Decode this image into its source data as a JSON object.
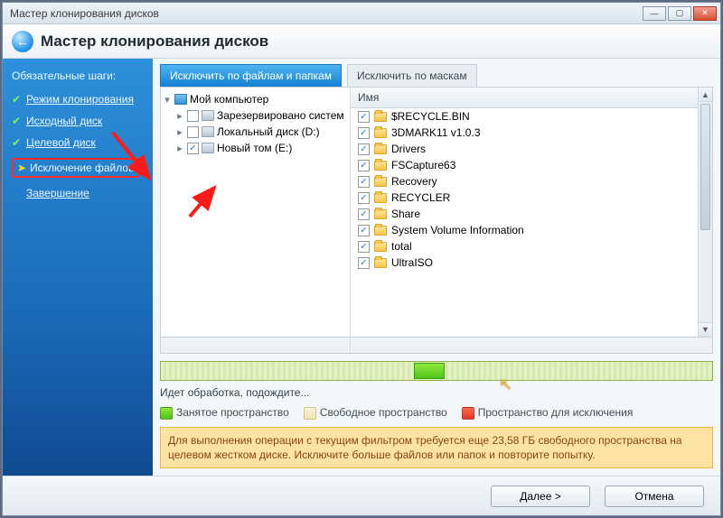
{
  "window": {
    "title": "Мастер клонирования дисков"
  },
  "header": {
    "title": "Мастер клонирования дисков"
  },
  "sidebar": {
    "section": "Обязательные шаги:",
    "steps": [
      {
        "label": "Режим клонирования",
        "done": true
      },
      {
        "label": "Исходный диск",
        "done": true
      },
      {
        "label": "Целевой диск",
        "done": true
      },
      {
        "label": "Исключение файлов",
        "current": true
      },
      {
        "label": "Завершение",
        "done": false
      }
    ]
  },
  "tabs": {
    "by_files": "Исключить по файлам и папкам",
    "by_masks": "Исключить по маскам"
  },
  "tree": {
    "root": "Мой компьютер",
    "nodes": [
      {
        "label": "Зарезервировано систем",
        "checked": false
      },
      {
        "label": "Локальный диск (D:)",
        "checked": false
      },
      {
        "label": "Новый том (E:)",
        "checked": true
      }
    ]
  },
  "list": {
    "header": "Имя",
    "items": [
      {
        "label": "$RECYCLE.BIN"
      },
      {
        "label": "3DMARK11 v1.0.3"
      },
      {
        "label": "Drivers"
      },
      {
        "label": "FSCapture63"
      },
      {
        "label": "Recovery"
      },
      {
        "label": "RECYCLER"
      },
      {
        "label": "Share"
      },
      {
        "label": "System Volume Information"
      },
      {
        "label": "total"
      },
      {
        "label": "UltraISO"
      }
    ]
  },
  "status": "Идет обработка, подождите...",
  "legend": {
    "used": "Занятое пространство",
    "free": "Свободное пространство",
    "excl": "Пространство для исключения"
  },
  "warning": "Для выполнения операции с текущим фильтром требуется еще 23,58 ГБ свободного пространства на целевом жестком диске. Исключите больше файлов или папок и повторите попытку.",
  "footer": {
    "next": "Далее >",
    "cancel": "Отмена"
  }
}
